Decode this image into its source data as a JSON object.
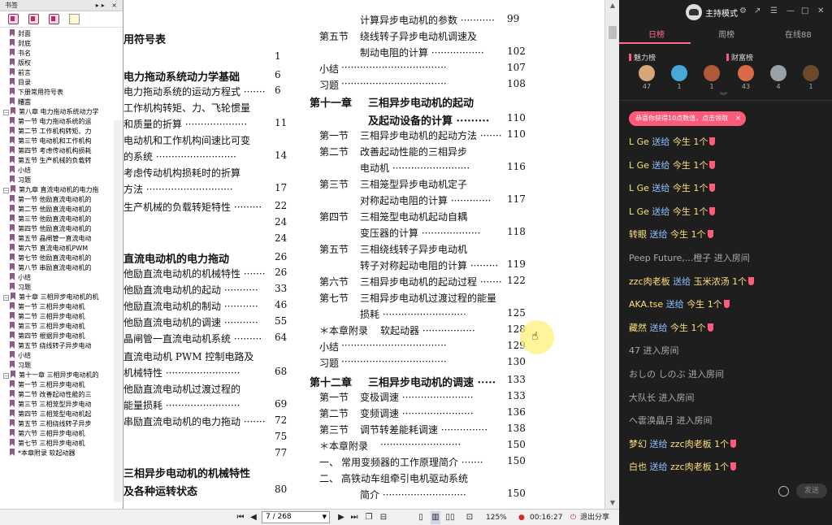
{
  "sidebar": {
    "title": "书签",
    "controls": "▸▸ ×",
    "items": [
      {
        "label": "封面",
        "lvl": 1
      },
      {
        "label": "封底",
        "lvl": 1
      },
      {
        "label": "书名",
        "lvl": 1
      },
      {
        "label": "版权",
        "lvl": 1
      },
      {
        "label": "前言",
        "lvl": 1
      },
      {
        "label": "目录",
        "lvl": 1
      },
      {
        "label": "下册常用符号表",
        "lvl": 1
      },
      {
        "label": "绪言",
        "lvl": 1,
        "selected": true
      },
      {
        "label": "第八章 电力拖动系统动力学",
        "lvl": 0,
        "exp": "−"
      },
      {
        "label": "第一节 电力拖动系统的运",
        "lvl": 1
      },
      {
        "label": "第二节 工作机构转矩、力",
        "lvl": 1
      },
      {
        "label": "第三节 电动机和工作机构",
        "lvl": 1
      },
      {
        "label": "第四节 考虑传动机构损耗",
        "lvl": 1
      },
      {
        "label": "第五节 生产机械的负载转",
        "lvl": 1
      },
      {
        "label": "小结",
        "lvl": 1
      },
      {
        "label": "习题",
        "lvl": 1
      },
      {
        "label": "第九章 直流电动机的电力拖",
        "lvl": 0,
        "exp": "−"
      },
      {
        "label": "第一节 他励直流电动机的",
        "lvl": 1
      },
      {
        "label": "第二节 他励直流电动机的",
        "lvl": 1
      },
      {
        "label": "第三节 他励直流电动机的",
        "lvl": 1
      },
      {
        "label": "第四节 他励直流电动机的",
        "lvl": 1
      },
      {
        "label": "第五节 晶闸管一直流电动",
        "lvl": 1
      },
      {
        "label": "第六节 直流电动机PWM",
        "lvl": 1
      },
      {
        "label": "第七节 他励直流电动机的",
        "lvl": 1
      },
      {
        "label": "第八节 串励直流电动机的",
        "lvl": 1
      },
      {
        "label": "小结",
        "lvl": 1
      },
      {
        "label": "习题",
        "lvl": 1
      },
      {
        "label": "第十章 三相异步电动机的机",
        "lvl": 0,
        "exp": "−"
      },
      {
        "label": "第一节 三相异步电动机",
        "lvl": 1
      },
      {
        "label": "第二节 三相异步电动机",
        "lvl": 1
      },
      {
        "label": "第三节 三相异步电动机",
        "lvl": 1
      },
      {
        "label": "第四节 根据异步电动机",
        "lvl": 1
      },
      {
        "label": "第五节 绕线转子异步电动",
        "lvl": 1
      },
      {
        "label": "小结",
        "lvl": 1
      },
      {
        "label": "习题",
        "lvl": 1
      },
      {
        "label": "第十一章 三相异步电动机的",
        "lvl": 0,
        "exp": "−"
      },
      {
        "label": "第一节 三相异步电动机",
        "lvl": 1
      },
      {
        "label": "第二节 改善起动性能的三",
        "lvl": 1
      },
      {
        "label": "第三节 三相笼型异步电动",
        "lvl": 1
      },
      {
        "label": "第四节 三相笼型电动机起",
        "lvl": 1
      },
      {
        "label": "第五节 三相绕线转子异步",
        "lvl": 1
      },
      {
        "label": "第六节 三相异步电动机",
        "lvl": 1
      },
      {
        "label": "第七节 三相异步电动机",
        "lvl": 1
      },
      {
        "label": "*本章附录 软起动器",
        "lvl": 1
      }
    ]
  },
  "page": {
    "left": [
      {
        "text": "用符号表",
        "style": "h",
        "page": ""
      },
      {
        "text": "",
        "style": "n",
        "page": "1"
      },
      {
        "text": "电力拖动系统动力学基础",
        "style": "h",
        "page": "6"
      },
      {
        "text": "电力拖动系统的运动方程式 ·······",
        "style": "n",
        "page": "6"
      },
      {
        "text": "工作机构转矩、力、飞轮惯量",
        "style": "n",
        "page": ""
      },
      {
        "text": "和质量的折算 ····················",
        "style": "n",
        "page": "11"
      },
      {
        "text": "电动机和工作机构间速比可变",
        "style": "n",
        "page": ""
      },
      {
        "text": "的系统 ··························",
        "style": "n",
        "page": "14"
      },
      {
        "text": "考虑传动机构损耗时的折算",
        "style": "n",
        "page": ""
      },
      {
        "text": "方法 ····························",
        "style": "n",
        "page": "17"
      },
      {
        "text": "生产机械的负载转矩特性 ·········",
        "style": "n",
        "page": "22"
      },
      {
        "text": "",
        "style": "n",
        "page": "24"
      },
      {
        "text": "",
        "style": "n",
        "page": "24"
      },
      {
        "text": "直流电动机的电力拖动",
        "style": "h",
        "page": "26"
      },
      {
        "text": "他励直流电动机的机械特性 ·······",
        "style": "n",
        "page": "26"
      },
      {
        "text": "他励直流电动机的起动 ···········",
        "style": "n",
        "page": "33"
      },
      {
        "text": "他励直流电动机的制动 ···········",
        "style": "n",
        "page": "46"
      },
      {
        "text": "他励直流电动机的调速 ···········",
        "style": "n",
        "page": "55"
      },
      {
        "text": "晶闸管一直流电动机系统 ·········",
        "style": "n",
        "page": "64"
      },
      {
        "text": "直流电动机 PWM 控制电路及",
        "style": "n",
        "page": ""
      },
      {
        "text": "机械特性 ························",
        "style": "n",
        "page": "68"
      },
      {
        "text": "他励直流电动机过渡过程的",
        "style": "n",
        "page": ""
      },
      {
        "text": "能量损耗 ························",
        "style": "n",
        "page": "69"
      },
      {
        "text": "串励直流电动机的电力拖动 ·······",
        "style": "n",
        "page": "72"
      },
      {
        "text": "",
        "style": "n",
        "page": "75"
      },
      {
        "text": "",
        "style": "n",
        "page": "77"
      },
      {
        "text": "三相异步电动机的机械特性",
        "style": "h",
        "page": ""
      },
      {
        "text": "及各种运转状态",
        "style": "h",
        "page": "80"
      }
    ],
    "right": [
      {
        "sec": "",
        "text": "计算异步电动机的参数 ···········",
        "page": "99",
        "style": "n"
      },
      {
        "sec": "第五节",
        "text": "绕线转子异步电动机调速及",
        "page": "",
        "style": "n"
      },
      {
        "sec": "",
        "text": "制动电阻的计算 ·················",
        "page": "102",
        "style": "n"
      },
      {
        "sec": "小结",
        "text": "··································",
        "page": "107",
        "style": "n"
      },
      {
        "sec": "习题",
        "text": "··································",
        "page": "108",
        "style": "n"
      },
      {
        "sec": "第十一章",
        "text": "三相异步电动机的起动",
        "page": "",
        "style": "h"
      },
      {
        "sec": "",
        "text": "及起动设备的计算 ·········",
        "page": "110",
        "style": "h"
      },
      {
        "sec": "第一节",
        "text": "三相异步电动机的起动方法 ·······",
        "page": "110",
        "style": "n"
      },
      {
        "sec": "第二节",
        "text": "改善起动性能的三相异步",
        "page": "",
        "style": "n"
      },
      {
        "sec": "",
        "text": "电动机 ·························",
        "page": "116",
        "style": "n"
      },
      {
        "sec": "第三节",
        "text": "三相笼型异步电动机定子",
        "page": "",
        "style": "n"
      },
      {
        "sec": "",
        "text": "对称起动电阻的计算 ·············",
        "page": "117",
        "style": "n"
      },
      {
        "sec": "第四节",
        "text": "三相笼型电动机起动自耦",
        "page": "",
        "style": "n"
      },
      {
        "sec": "",
        "text": "变压器的计算 ···················",
        "page": "118",
        "style": "n"
      },
      {
        "sec": "第五节",
        "text": "三相绕线转子异步电动机",
        "page": "",
        "style": "n"
      },
      {
        "sec": "",
        "text": "转子对称起动电阻的计算 ·········",
        "page": "119",
        "style": "n"
      },
      {
        "sec": "第六节",
        "text": "三相异步电动机的起动过程 ·······",
        "page": "122",
        "style": "n"
      },
      {
        "sec": "第七节",
        "text": "三相异步电动机过渡过程的能量",
        "page": "",
        "style": "n"
      },
      {
        "sec": "",
        "text": "损耗 ···························",
        "page": "125",
        "style": "n"
      },
      {
        "sec": "＊本章附录",
        "text": "软起动器 ·················",
        "page": "128",
        "style": "n"
      },
      {
        "sec": "小结",
        "text": "··································",
        "page": "129",
        "style": "n"
      },
      {
        "sec": "习题",
        "text": "··································",
        "page": "130",
        "style": "n"
      },
      {
        "sec": "第十二章",
        "text": "三相异步电动机的调速 ·····",
        "page": "133",
        "style": "h"
      },
      {
        "sec": "第一节",
        "text": "变极调速 ·······················",
        "page": "133",
        "style": "n"
      },
      {
        "sec": "第二节",
        "text": "变频调速 ·······················",
        "page": "136",
        "style": "n"
      },
      {
        "sec": "第三节",
        "text": "调节转差能耗调速 ···············",
        "page": "138",
        "style": "n"
      },
      {
        "sec": "＊本章附录",
        "text": "··························",
        "page": "150",
        "style": "n"
      },
      {
        "sec": "一、",
        "text": "常用变频器的工作原理简介 ·······",
        "page": "150",
        "style": "n"
      },
      {
        "sec": "二、",
        "text": "高铁动车组牵引电机驱动系统",
        "page": "",
        "style": "n"
      },
      {
        "sec": "",
        "text": "简介 ···························",
        "page": "150",
        "style": "n"
      }
    ]
  },
  "toolbar": {
    "page_value": "7 / 268",
    "zoom": "125%",
    "timer": "00:16:27",
    "exit_label": "退出分享"
  },
  "live": {
    "host_title": "主持模式",
    "top_icons": [
      "⚙",
      "↗",
      "☰",
      "—",
      "□",
      "✕"
    ],
    "tabs": [
      "日榜",
      "周榜",
      "在线88"
    ],
    "rank_labels": [
      "魅力榜",
      "财富榜"
    ],
    "charm": [
      {
        "n": "47",
        "c": "#d9a777"
      },
      {
        "n": "1",
        "c": "#48a9d8"
      },
      {
        "n": "1",
        "c": "#b05a38"
      }
    ],
    "wealth": [
      {
        "n": "43",
        "c": "#d86a48"
      },
      {
        "n": "4",
        "c": "#9aa0a8"
      },
      {
        "n": "1",
        "c": "#6a4a2a"
      }
    ],
    "fold": "︾",
    "notice": "恭喜你获得10点数值，点击领取",
    "notice_close": "×",
    "messages": [
      {
        "u": "L Ge",
        "a": "送给",
        "t": "今生",
        "x": "1个",
        "gift": true
      },
      {
        "u": "L Ge",
        "a": "送给",
        "t": "今生",
        "x": "1个",
        "gift": true
      },
      {
        "u": "L Ge",
        "a": "送给",
        "t": "今生",
        "x": "1个",
        "gift": true
      },
      {
        "u": "L Ge",
        "a": "送给",
        "t": "今生",
        "x": "1个",
        "gift": true
      },
      {
        "u": "转眼",
        "a": "送给",
        "t": "今生",
        "x": "1个",
        "gift": true
      },
      {
        "u": "Peep Future,...橙子",
        "a": "进入房间",
        "t": "",
        "x": "",
        "gift": false
      },
      {
        "u": "zzc肉老板",
        "a": "送给",
        "t": "玉米浓汤",
        "x": "1个",
        "gift": true
      },
      {
        "u": "AKA.tse",
        "a": "送给",
        "t": "今生",
        "x": "1个",
        "gift": true
      },
      {
        "u": "藏然",
        "a": "送给",
        "t": "今生",
        "x": "1个",
        "gift": true
      },
      {
        "u": "47",
        "a": "进入房间",
        "t": "",
        "x": "",
        "gift": false
      },
      {
        "u": "おしの しのぶ",
        "a": "进入房间",
        "t": "",
        "x": "",
        "gift": false
      },
      {
        "u": "大队长",
        "a": "进入房间",
        "t": "",
        "x": "",
        "gift": false
      },
      {
        "u": "へ雲涣皛月",
        "a": "进入房间",
        "t": "",
        "x": "",
        "gift": false
      },
      {
        "u": "梦幻",
        "a": "送给",
        "t": "zzc肉老板",
        "x": "1个",
        "gift": true
      },
      {
        "u": "白也",
        "a": "送给",
        "t": "zzc肉老板",
        "x": "1个",
        "gift": true
      }
    ],
    "send_label": "发送",
    "emoji_icon": "smile-icon"
  }
}
